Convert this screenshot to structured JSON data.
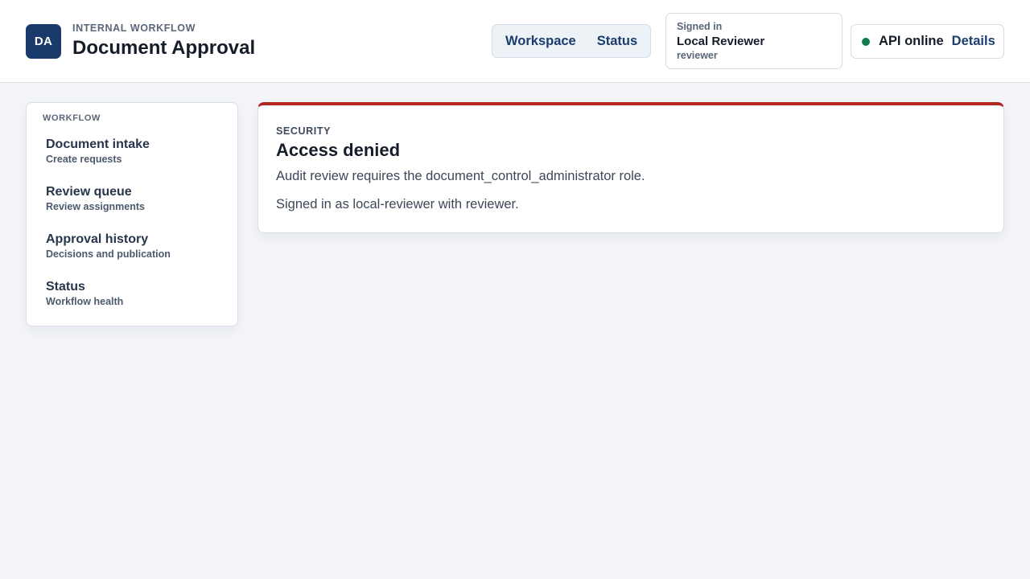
{
  "header": {
    "logo_text": "DA",
    "eyebrow": "INTERNAL WORKFLOW",
    "title": "Document Approval",
    "nav": [
      "Workspace",
      "Status"
    ],
    "user": {
      "label": "Signed in",
      "name": "Local Reviewer",
      "role": "reviewer"
    },
    "api": {
      "status": "API online",
      "status_color": "#12794e",
      "details_label": "Details"
    }
  },
  "sidebar": {
    "heading": "WORKFLOW",
    "items": [
      {
        "title": "Document intake",
        "subtitle": "Create requests"
      },
      {
        "title": "Review queue",
        "subtitle": "Review assignments"
      },
      {
        "title": "Approval history",
        "subtitle": "Decisions and publication"
      },
      {
        "title": "Status",
        "subtitle": "Workflow health"
      }
    ]
  },
  "main": {
    "eyebrow": "SECURITY",
    "title": "Access denied",
    "messages": [
      "Audit review requires the document_control_administrator role.",
      "Signed in as local-reviewer with reviewer."
    ],
    "accent_color": "#b42720"
  }
}
